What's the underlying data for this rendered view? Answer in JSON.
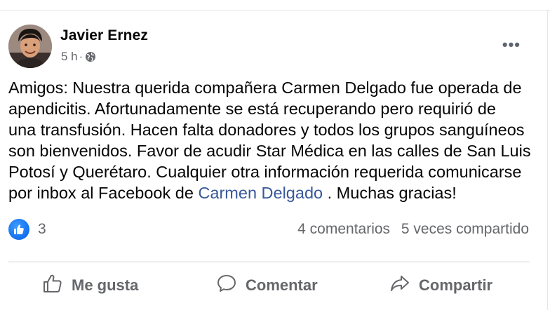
{
  "post": {
    "author": "Javier Ernez",
    "time": "5 h",
    "separator": "·",
    "more_label": "•••",
    "body_lines": [
      "Amigos: Nuestra querida compañera  Carmen Delgado fue operada de",
      "apendicitis. Afortunadamente se está recuperando pero requirió de",
      "una transfusión. Hacen falta donadores y todos los grupos sanguíneos",
      "son bienvenidos. Favor de acudir Star Médica en las calles de San Luis",
      "Potosí y Querétaro. Cualquier otra información requerida comunicarse"
    ],
    "last_line_prefix": "por inbox al Facebook de ",
    "mention": "Carmen Delgado",
    "last_line_suffix": " . Muchas gracias!"
  },
  "stats": {
    "reactions": "3",
    "comments": "4 comentarios",
    "shares": "5 veces compartido"
  },
  "actions": {
    "like": "Me gusta",
    "comment": "Comentar",
    "share": "Compartir"
  },
  "colors": {
    "link": "#385898",
    "muted": "#65676b",
    "like_blue": "#1877f2"
  },
  "icons": [
    "globe-icon",
    "more-icon",
    "like-reaction-icon",
    "thumbs-up-icon",
    "comment-icon",
    "share-icon"
  ]
}
